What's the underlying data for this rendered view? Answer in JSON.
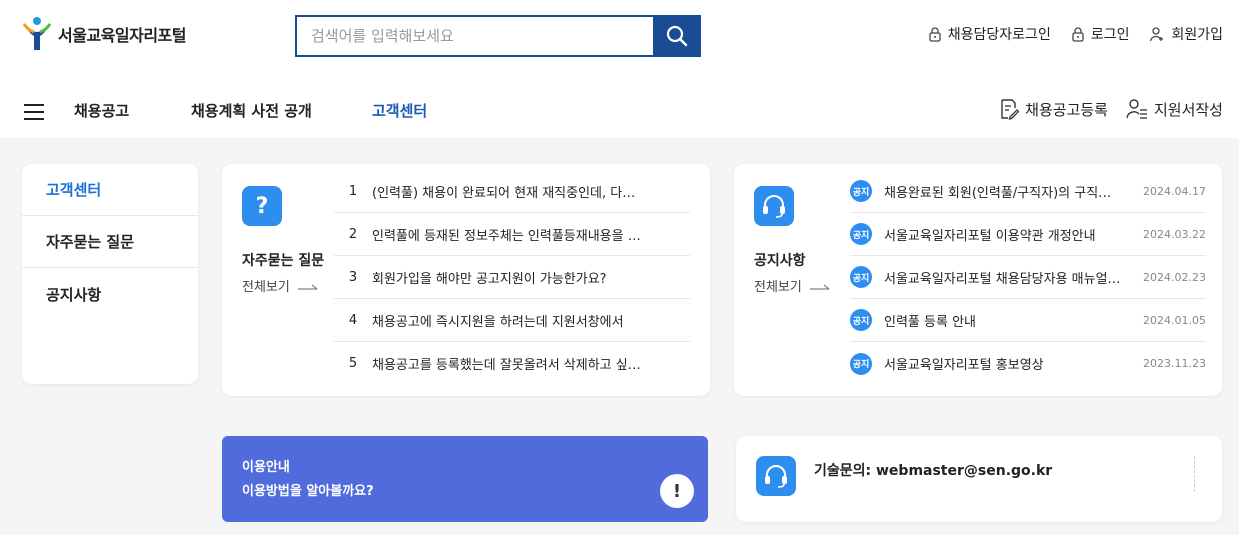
{
  "header": {
    "logo_text": "서울교육일자리포털",
    "search_placeholder": "검색어를 입력해보세요",
    "util": {
      "recruiter_login": "채용담당자로그인",
      "login": "로그인",
      "signup": "회원가입"
    }
  },
  "gnb": {
    "items": [
      "채용공고",
      "채용계획 사전 공개",
      "고객센터"
    ],
    "active_index": 2,
    "right": {
      "post_job": "채용공고등록",
      "write_application": "지원서작성"
    }
  },
  "sidenav": {
    "items": [
      "고객센터",
      "자주묻는 질문",
      "공지사항"
    ],
    "active_index": 0
  },
  "faq": {
    "title": "자주묻는 질문",
    "more": "전체보기",
    "icon": "?",
    "items": [
      {
        "num": "1",
        "q": "(인력풀) 채용이 완료되어 현재 재직중인데, 다…"
      },
      {
        "num": "2",
        "q": "인력풀에 등재된 정보주체는 인력풀등재내용을 …"
      },
      {
        "num": "3",
        "q": "회원가입을 해야만 공고지원이 가능한가요?"
      },
      {
        "num": "4",
        "q": "채용공고에 즉시지원을 하려는데 지원서창에서"
      },
      {
        "num": "5",
        "q": "채용공고를 등록했는데 잘못올려서 삭제하고 싶…"
      }
    ]
  },
  "notice": {
    "title": "공지사항",
    "more": "전체보기",
    "badge": "공지",
    "items": [
      {
        "title": "채용완료된 회원(인력풀/구직자)의 구직…",
        "date": "2024.04.17"
      },
      {
        "title": "서울교육일자리포털 이용약관 개정안내",
        "date": "2024.03.22"
      },
      {
        "title": "서울교육일자리포털 채용담당자용 매뉴얼…",
        "date": "2024.02.23"
      },
      {
        "title": "인력풀 등록 안내",
        "date": "2024.01.05"
      },
      {
        "title": "서울교육일자리포털 홍보영상",
        "date": "2023.11.23"
      }
    ]
  },
  "guide": {
    "title": "이용안내",
    "subtitle": "이용방법을 알아볼까요?",
    "icon": "!"
  },
  "tech": {
    "text": "기술문의: webmaster@sen.go.kr"
  },
  "colors": {
    "primary": "#1a4c96",
    "accent": "#2e8ef0",
    "active_text": "#1a6fd8",
    "guide_bg": "#4f6bdc"
  }
}
